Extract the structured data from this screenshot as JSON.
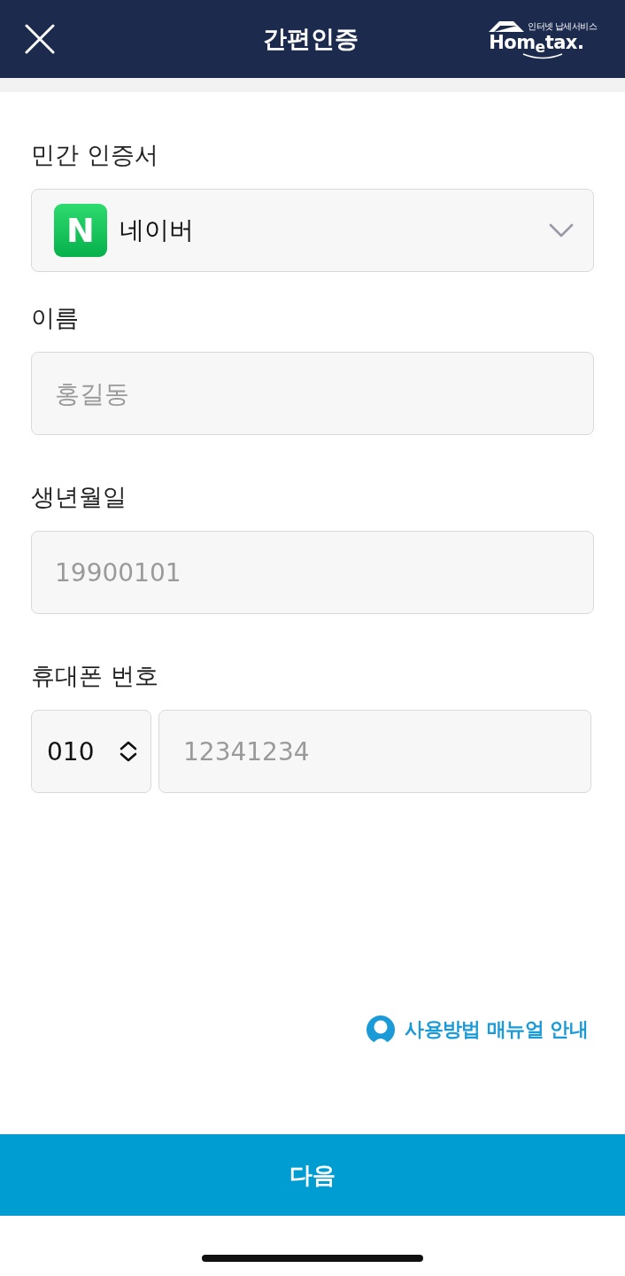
{
  "header": {
    "title": "간편인증",
    "logo": {
      "tagline": "인터넷 납세서비스",
      "wordmark": "Hom$_{e}$tax."
    }
  },
  "fields": [
    {
      "kind": "select",
      "label": "민간 인증서",
      "logo": "N",
      "value": "네이버"
    },
    {
      "kind": "text",
      "label": "이름",
      "placeholder": "홍길동"
    },
    {
      "kind": "text",
      "label": "생년월일",
      "placeholder": "19900101"
    },
    {
      "kind": "phone",
      "label": "휴대폰 번호",
      "prefix": "010",
      "placeholder": "12341234"
    }
  ],
  "manual_link": "사용방법 매뉴얼 안내",
  "next_button": "다음"
}
